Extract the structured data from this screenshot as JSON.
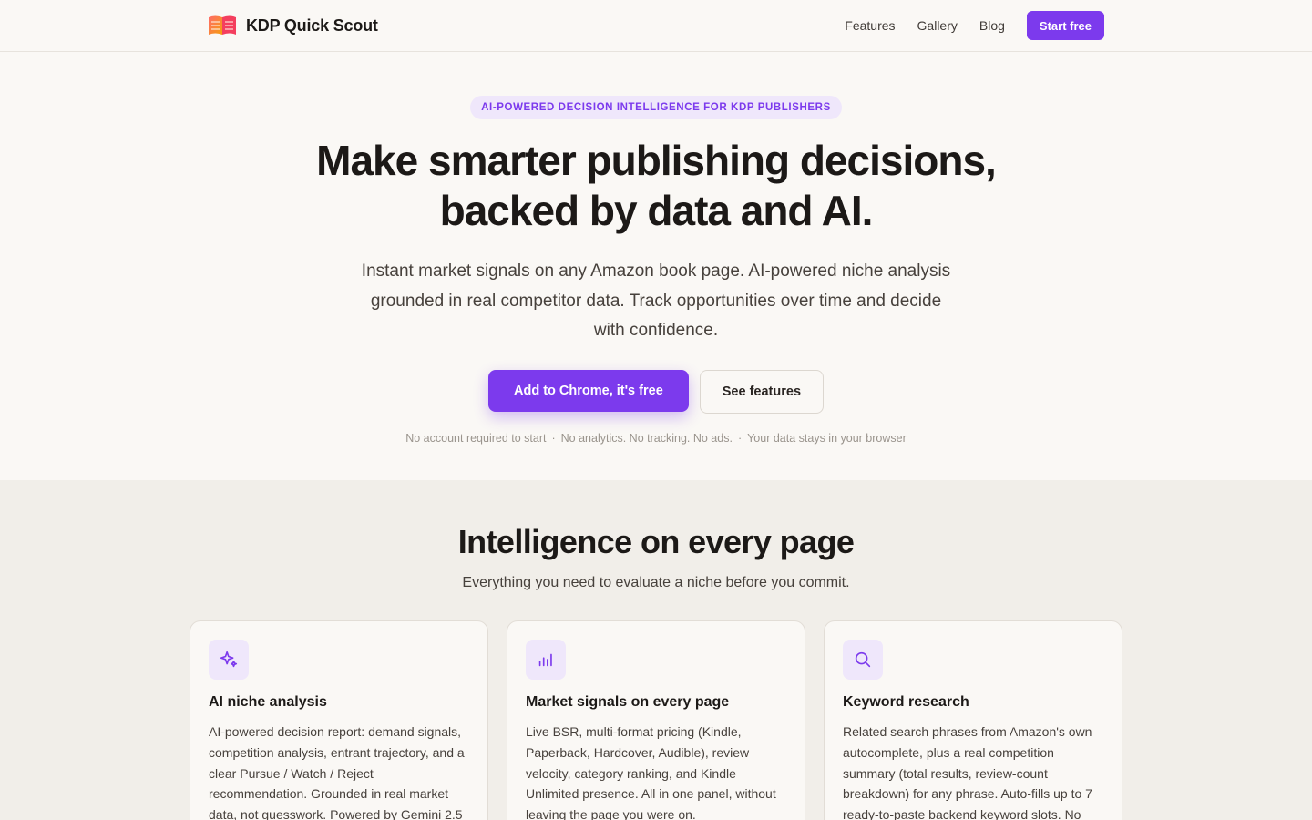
{
  "nav": {
    "brand": "KDP Quick Scout",
    "links": [
      "Features",
      "Gallery",
      "Blog"
    ],
    "cta": "Start free"
  },
  "hero": {
    "eyebrow": "AI-POWERED DECISION INTELLIGENCE FOR KDP PUBLISHERS",
    "title_line1": "Make smarter publishing decisions,",
    "title_line2": "backed by data and AI.",
    "subtitle": "Instant market signals on any Amazon book page. AI-powered niche analysis grounded in real competitor data. Track opportunities over time and decide with confidence.",
    "primary_cta": "Add to Chrome, it's free",
    "secondary_cta": "See features",
    "trust": [
      "No account required to start",
      "No analytics. No tracking. No ads.",
      "Your data stays in your browser"
    ]
  },
  "features": {
    "title": "Intelligence on every page",
    "subtitle": "Everything you need to evaluate a niche before you commit.",
    "cards": [
      {
        "icon": "sparkles-icon",
        "title": "AI niche analysis",
        "desc": "AI-powered decision report: demand signals, competition analysis, entrant trajectory, and a clear Pursue / Watch / Reject recommendation. Grounded in real market data, not guesswork. Powered by Gemini 2.5"
      },
      {
        "icon": "bar-chart-icon",
        "title": "Market signals on every page",
        "desc": "Live BSR, multi-format pricing (Kindle, Paperback, Hardcover, Audible), review velocity, category ranking, and Kindle Unlimited presence. All in one panel, without leaving the page you were on."
      },
      {
        "icon": "search-icon",
        "title": "Keyword research",
        "desc": "Related search phrases from Amazon's own autocomplete, plus a real competition summary (total results, review-count breakdown) for any phrase. Auto-fills up to 7 ready-to-paste backend keyword slots. No"
      }
    ]
  },
  "colors": {
    "accent": "#7c3aed",
    "accent_soft": "#efe7fb",
    "background": "#faf8f5",
    "section_bg": "#f1eee9"
  }
}
